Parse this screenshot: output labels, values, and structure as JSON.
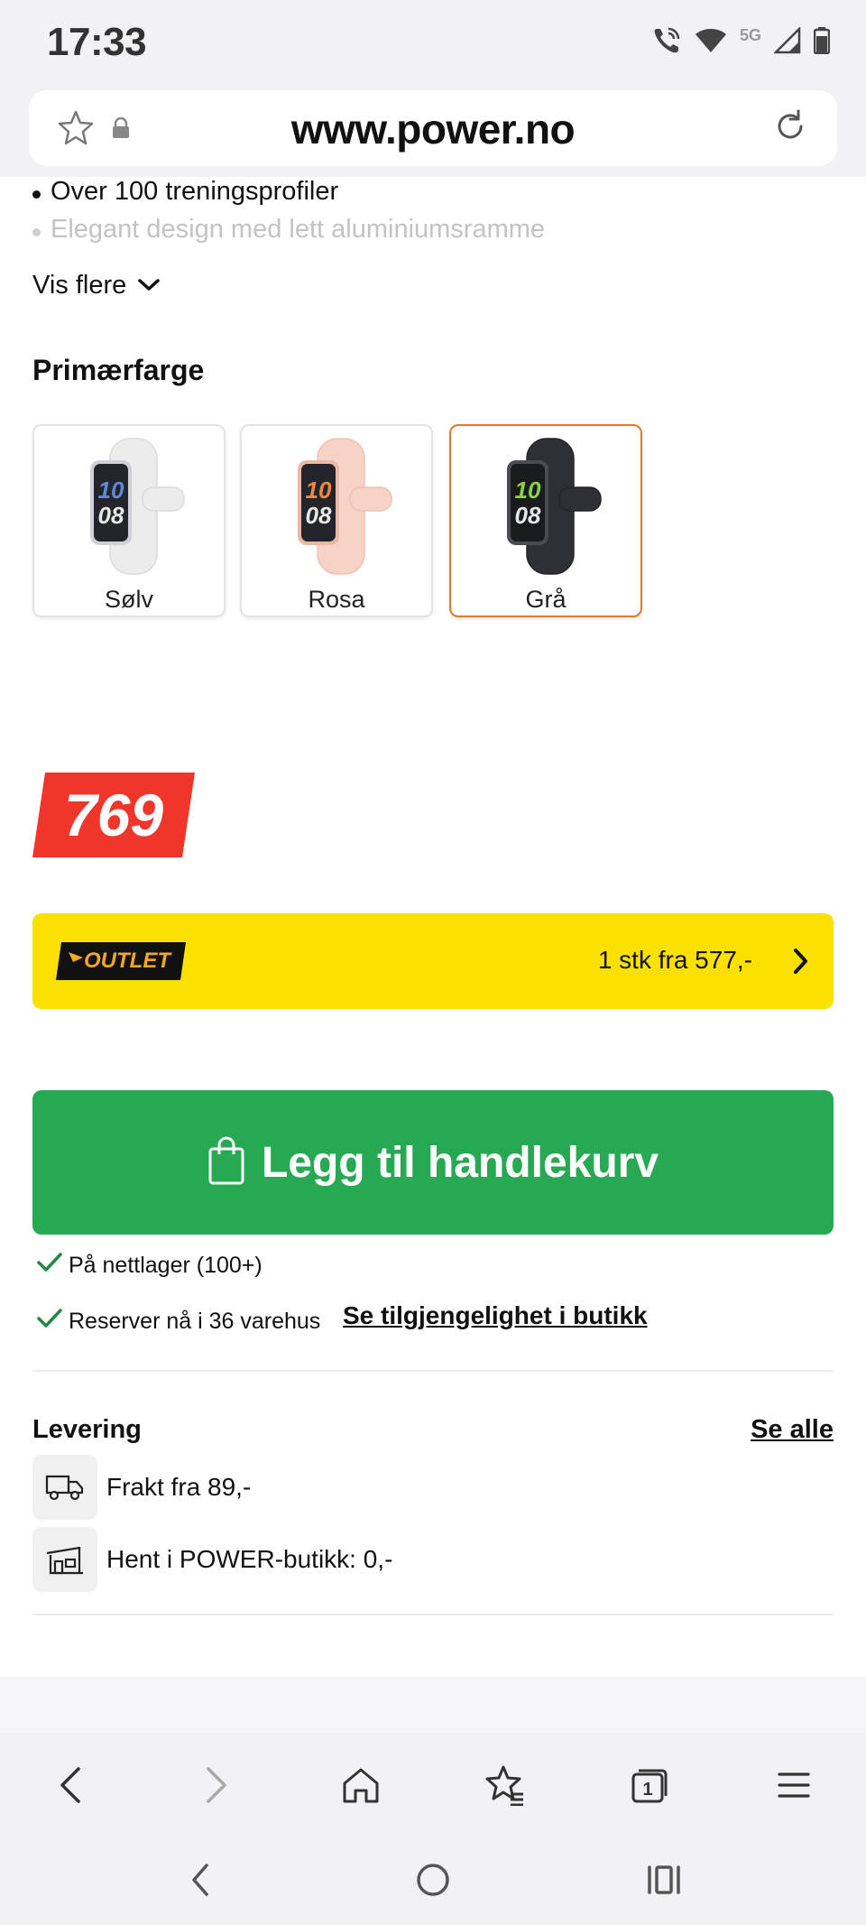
{
  "status_bar": {
    "time": "17:33",
    "network": "5G"
  },
  "browser": {
    "url": "www.power.no"
  },
  "features": [
    "Over 100 treningsprofiler",
    "Elegant design med lett aluminiumsramme"
  ],
  "show_more": "Vis flere",
  "color_section": {
    "title": "Primærfarge",
    "options": [
      {
        "label": "Sølv",
        "band_color": "#f0f0f0",
        "screen_accent": "#5a8ad8",
        "selected": false
      },
      {
        "label": "Rosa",
        "band_color": "#f6d3c6",
        "screen_accent": "#f08a3a",
        "selected": false
      },
      {
        "label": "Grå",
        "band_color": "#2e3035",
        "screen_accent": "#8bd43b",
        "selected": true
      }
    ]
  },
  "price": {
    "value": "769",
    "tag_color": "#f0352b"
  },
  "outlet": {
    "badge": "OUTLET",
    "offer": "1 stk fra 577,-"
  },
  "cart_button": {
    "label": "Legg til handlekurv",
    "color": "#27a853"
  },
  "stock": {
    "online": "På nettlager (100+)",
    "reserve": "Reserver nå i 36 varehus",
    "store_link": "Se tilgjengelighet i butikk"
  },
  "delivery": {
    "title": "Levering",
    "see_all": "Se alle",
    "options": [
      {
        "icon": "truck-icon",
        "text": "Frakt fra 89,-"
      },
      {
        "icon": "store-icon",
        "text": "Hent i POWER-butikk: 0,-"
      }
    ]
  },
  "toolbar_icons": [
    "back-icon",
    "forward-icon",
    "home-icon",
    "bookmarks-icon",
    "tabs-icon",
    "menu-icon"
  ],
  "tabs_count": "1",
  "nav_icons": [
    "nav-back-icon",
    "nav-home-icon",
    "nav-recents-icon"
  ]
}
